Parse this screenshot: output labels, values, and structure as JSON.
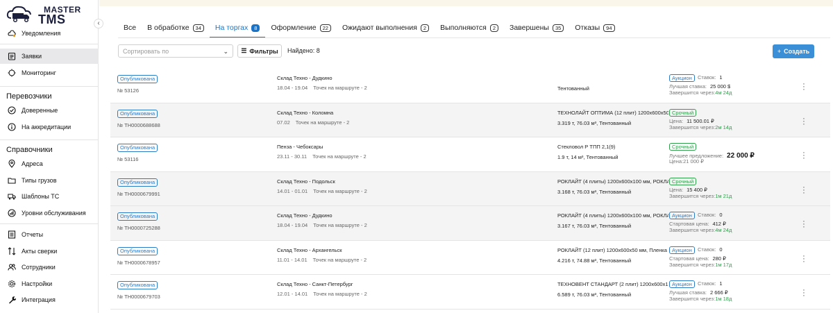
{
  "brand": {
    "line1": "MASTER",
    "line2": "TMS"
  },
  "sidebar": {
    "notifications": "Уведомления",
    "requests": "Заявки",
    "monitoring": "Мониторинг",
    "carriers_head": "Перевозчики",
    "trusted": "Доверенные",
    "accreditation": "На аккредитации",
    "refs_head": "Справочники",
    "addresses": "Адреса",
    "cargo_types": "Типы грузов",
    "vehicle_templates": "Шаблоны ТС",
    "service_levels": "Уровни обслуживания",
    "reports": "Отчеты",
    "reconciliation": "Акты сверки",
    "employees": "Сотрудники",
    "settings": "Настройки",
    "integration": "Интеграция"
  },
  "tabs": [
    {
      "label": "Все",
      "count": ""
    },
    {
      "label": "В обработке",
      "count": "34"
    },
    {
      "label": "На торгах",
      "count": "8"
    },
    {
      "label": "Оформление",
      "count": "22"
    },
    {
      "label": "Ожидают выполнения",
      "count": "2"
    },
    {
      "label": "Выполняются",
      "count": "2"
    },
    {
      "label": "Завершены",
      "count": "35"
    },
    {
      "label": "Отказы",
      "count": "94"
    }
  ],
  "toolbar": {
    "sort_placeholder": "Сортировать по",
    "filters": "Фильтры",
    "found": "Найдено: 8",
    "create": "Создать"
  },
  "rows": [
    {
      "status": "Опубликована",
      "number": "№ 53126",
      "route": "Склад Техно - Дудкино",
      "dates": "18.04 - 19.04",
      "points": "Точек на маршруте - 2",
      "cargo": "",
      "cargo2": "Тентованный",
      "tag": "Аукцион",
      "tagtype": "auction",
      "stakes_label": "Ставок:",
      "stakes": "1",
      "l2_label": "Лучшая ставка:",
      "l2_value": "25 000 $",
      "l3_label": "Завершится через:",
      "l3_value": "4м 24д"
    },
    {
      "status": "Опубликована",
      "number": "№ ТН0000688688",
      "route": "Склад Техно - Коломна",
      "dates": "07.02",
      "points": "Точек на маршруте - 2",
      "cargo": "ТЕХНОЛАЙТ ОПТИМА (12 плит) 1200x600x50 мм",
      "cargo2": "3.319 т, 76.03 м³, Тентованный",
      "tag": "Срочный",
      "tagtype": "urgent",
      "stakes_label": "",
      "stakes": "",
      "l2_label": "Цена:",
      "l2_value": "11 500.01 ₽",
      "l3_label": "Завершится через:",
      "l3_value": "2м 14д"
    },
    {
      "status": "Опубликована",
      "number": "№ 53116",
      "route": "Пенза - Чебоксары",
      "dates": "23.11 - 30.11",
      "points": "Точек на маршруте - 2",
      "cargo": "Стекловол Р ТПП 2,1(9)",
      "cargo2": "1.9 т, 14 м³, Тентованный",
      "tag": "Срочный",
      "tagtype": "urgent",
      "stakes_label": "",
      "stakes": "",
      "l2_label": "Лучшее предложение:",
      "l2_value": "22 000 ₽",
      "l3_label": "Цена:",
      "l3_value": "21 000 ₽"
    },
    {
      "status": "Опубликована",
      "number": "№ ТН0000679991",
      "route": "Склад Техно - Подольск",
      "dates": "14.01 - 01.01",
      "points": "Точек на маршруте - 2",
      "cargo": "РОКЛАЙТ (4 плиты) 1200x600x100 мм, РОКЛАЙТ...",
      "cargo2": "3.168 т, 76.03 м³, Тентованный",
      "tag": "Срочный",
      "tagtype": "urgent",
      "stakes_label": "",
      "stakes": "",
      "l2_label": "Цена:",
      "l2_value": "15 400 ₽",
      "l3_label": "Завершится через:",
      "l3_value": "1м 21д"
    },
    {
      "status": "Опубликована",
      "number": "№ ТН0000725288",
      "route": "Склад Техно - Дудкино",
      "dates": "18.04 - 19.04",
      "points": "Точек на маршруте - 2",
      "cargo": "РОКЛАЙТ (4 плиты) 1200x600x100 мм, РОКЛАЙ...",
      "cargo2": "3.167 т, 76.03 м³, Тентованный",
      "tag": "Аукцион",
      "tagtype": "auction",
      "stakes_label": "Ставок:",
      "stakes": "0",
      "l2_label": "Стартовая цена:",
      "l2_value": "412 ₽",
      "l3_label": "Завершится через:",
      "l3_value": "4м 24д"
    },
    {
      "status": "Опубликована",
      "number": "№ ТН0000678957",
      "route": "Склад Техно - Архангельск",
      "dates": "11.01 - 14.01",
      "points": "Точек на маршруте - 2",
      "cargo": "РОКЛАЙТ (12 плит) 1200x600x50 мм, Пленка п...",
      "cargo2": "4.216 т, 74.88 м³, Тентованный",
      "tag": "Аукцион",
      "tagtype": "auction",
      "stakes_label": "Ставок:",
      "stakes": "0",
      "l2_label": "Стартовая цена:",
      "l2_value": "280 ₽",
      "l3_label": "Завершится через:",
      "l3_value": "1м 17д"
    },
    {
      "status": "Опубликована",
      "number": "№ ТН0000679703",
      "route": "Склад Техно - Санкт-Петербург",
      "dates": "12.01 - 14.01",
      "points": "Точек на маршруте - 2",
      "cargo": "ТЕХНОВЕНТ СТАНДАРТ (2 плит) 1200x600x150...",
      "cargo2": "6.589 т, 76.03 м³, Тентованный",
      "tag": "Аукцион",
      "tagtype": "auction",
      "stakes_label": "Ставок:",
      "stakes": "1",
      "l2_label": "Лучшая ставка:",
      "l2_value": "2 666 ₽",
      "l3_label": "Завершится через:",
      "l3_value": "1м 18д"
    }
  ]
}
